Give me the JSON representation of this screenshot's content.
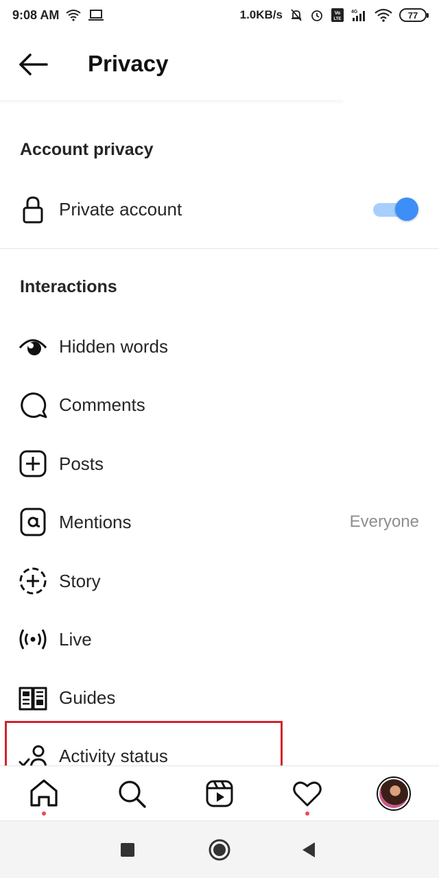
{
  "status_bar": {
    "time": "9:08 AM",
    "network_speed": "1.0KB/s",
    "network_type": "4G",
    "volte": "Vo LTE",
    "battery": "77"
  },
  "header": {
    "title": "Privacy",
    "back_icon": "arrow-left-icon"
  },
  "account_privacy": {
    "section_title": "Account privacy",
    "private_account": {
      "label": "Private account",
      "icon": "lock-icon",
      "toggle_on": true,
      "accent_color": "#3e8ef7"
    }
  },
  "interactions": {
    "section_title": "Interactions",
    "items": [
      {
        "label": "Hidden words",
        "icon": "eye-icon",
        "value": ""
      },
      {
        "label": "Comments",
        "icon": "comment-bubble-icon",
        "value": ""
      },
      {
        "label": "Posts",
        "icon": "plus-square-icon",
        "value": ""
      },
      {
        "label": "Mentions",
        "icon": "at-sign-icon",
        "value": "Everyone"
      },
      {
        "label": "Story",
        "icon": "story-plus-icon",
        "value": ""
      },
      {
        "label": "Live",
        "icon": "live-broadcast-icon",
        "value": ""
      },
      {
        "label": "Guides",
        "icon": "guide-book-icon",
        "value": ""
      },
      {
        "label": "Activity status",
        "icon": "activity-person-icon",
        "value": ""
      }
    ]
  },
  "highlight": {
    "color": "#d3232a",
    "target": "Activity status"
  },
  "tab_bar": {
    "items": [
      "home-icon",
      "search-icon",
      "reels-icon",
      "heart-icon",
      "profile-avatar"
    ],
    "notification_dot_color": "#ed4956"
  },
  "nav_bar": {
    "items": [
      "recents-square-icon",
      "home-circle-icon",
      "back-triangle-icon"
    ]
  }
}
